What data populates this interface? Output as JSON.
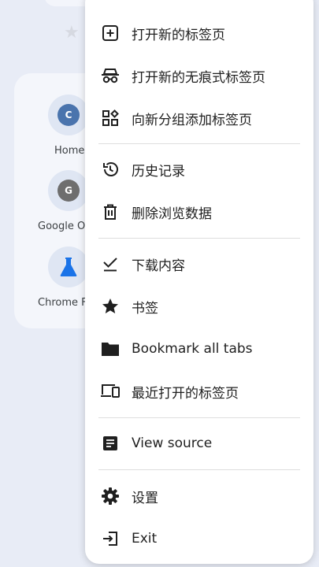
{
  "background": {
    "tiles": [
      {
        "initial": "C",
        "label": "Home",
        "color": "#4a74ad"
      },
      {
        "initial": "G",
        "label": "Google Op",
        "color": "#6e6e6e"
      },
      {
        "initial": "",
        "label": "Chrome F",
        "color": "#1a73e8"
      }
    ]
  },
  "menu": {
    "new_tab": "打开新的标签页",
    "new_incognito_tab": "打开新的无痕式标签页",
    "add_to_new_group": "向新分组添加标签页",
    "history": "历史记录",
    "clear_browsing_data": "删除浏览数据",
    "downloads": "下载内容",
    "bookmarks": "书签",
    "bookmark_all_tabs": "Bookmark all tabs",
    "recent_tabs": "最近打开的标签页",
    "view_source": "View source",
    "settings": "设置",
    "exit": "Exit"
  }
}
